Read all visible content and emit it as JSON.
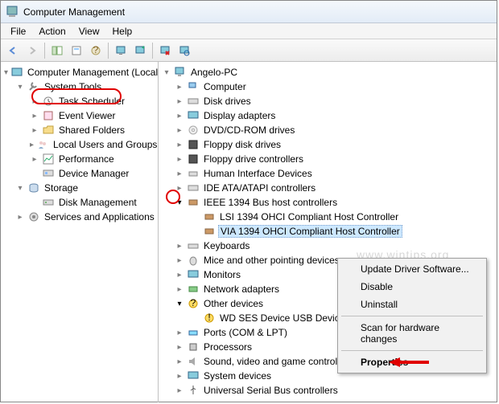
{
  "window": {
    "title": "Computer Management"
  },
  "menubar": [
    "File",
    "Action",
    "View",
    "Help"
  ],
  "left_root": "Computer Management (Local",
  "left": {
    "system_tools": "System Tools",
    "task_scheduler": "Task Scheduler",
    "event_viewer": "Event Viewer",
    "shared_folders": "Shared Folders",
    "local_users": "Local Users and Groups",
    "performance": "Performance",
    "device_manager": "Device Manager",
    "storage": "Storage",
    "disk_management": "Disk Management",
    "services_apps": "Services and Applications"
  },
  "right_root": "Angelo-PC",
  "right": {
    "computer": "Computer",
    "disk_drives": "Disk drives",
    "display_adapters": "Display adapters",
    "dvd": "DVD/CD-ROM drives",
    "floppy_disk": "Floppy disk drives",
    "floppy_ctrl": "Floppy drive controllers",
    "hid": "Human Interface Devices",
    "ide": "IDE ATA/ATAPI controllers",
    "ieee1394": "IEEE 1394 Bus host controllers",
    "lsi1394": "LSI 1394 OHCI Compliant Host Controller",
    "via1394": "VIA 1394 OHCI Compliant Host Controller",
    "keyboards": "Keyboards",
    "mice": "Mice and other pointing devices",
    "monitors": "Monitors",
    "network": "Network adapters",
    "other": "Other devices",
    "wd_ses": "WD SES Device USB Device",
    "ports": "Ports (COM & LPT)",
    "processors": "Processors",
    "sound": "Sound, video and game controllers",
    "system_devices": "System devices",
    "usb": "Universal Serial Bus controllers"
  },
  "ctx": {
    "update": "Update Driver Software...",
    "disable": "Disable",
    "uninstall": "Uninstall",
    "scan": "Scan for hardware changes",
    "properties": "Properties"
  },
  "watermark": "www.wintips.org"
}
